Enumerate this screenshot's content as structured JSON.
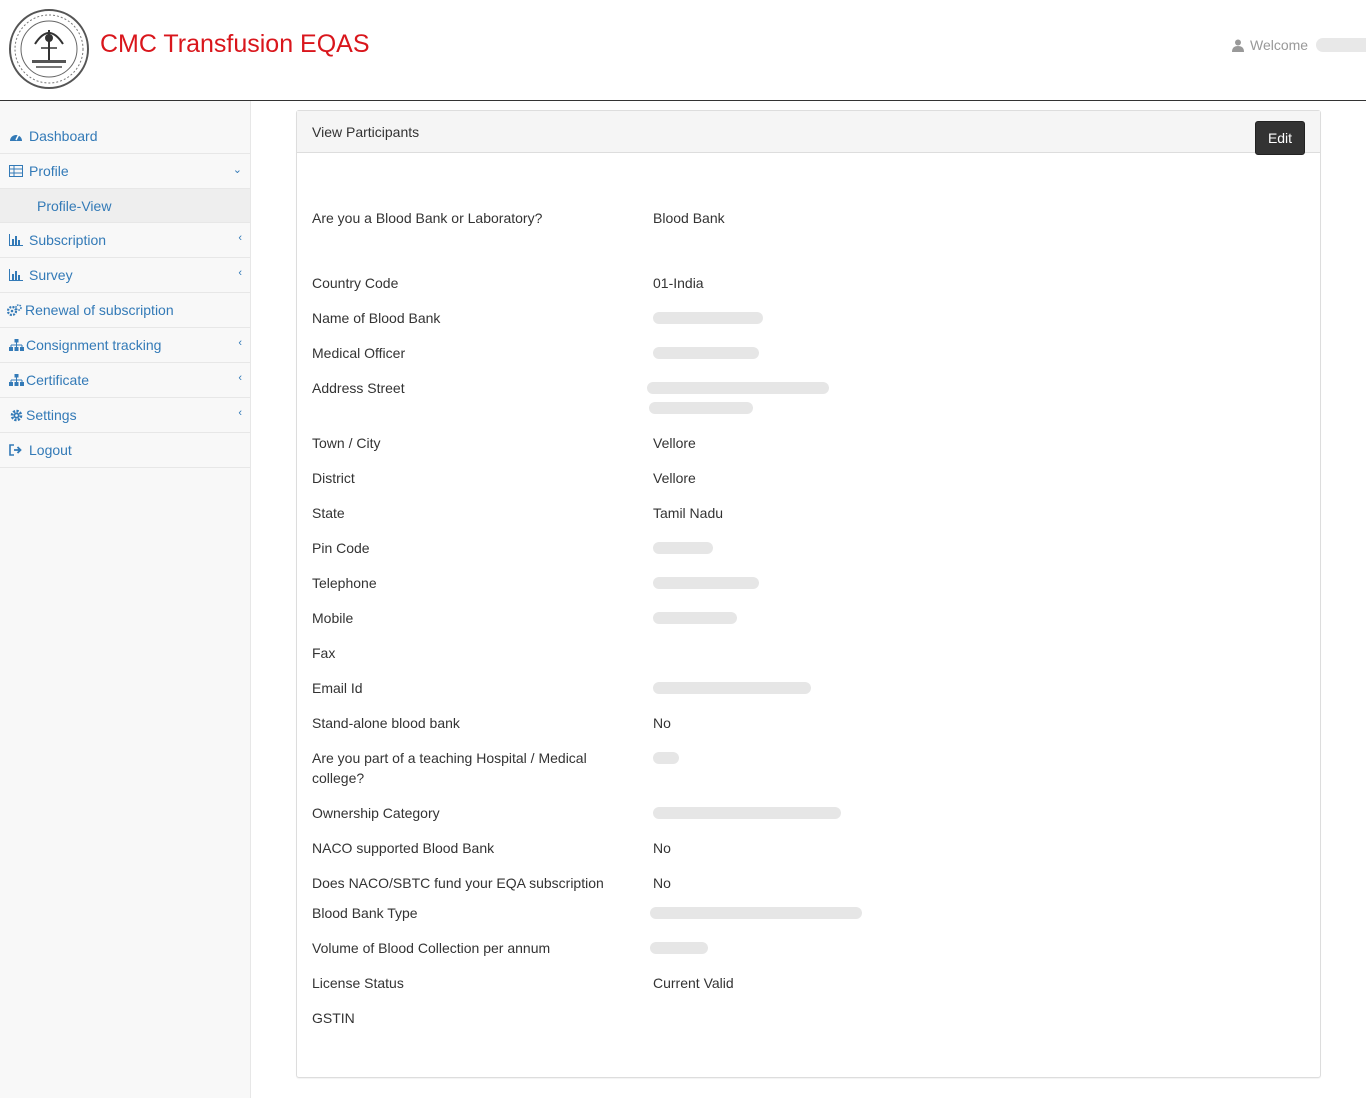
{
  "header": {
    "app_title": "CMC Transfusion EQAS",
    "welcome_label": "Welcome"
  },
  "sidebar": {
    "items": [
      {
        "label": "Dashboard",
        "icon": "dashboard-icon"
      },
      {
        "label": "Profile",
        "icon": "table-icon",
        "expanded": true
      },
      {
        "label": "Profile-View",
        "sub": true
      },
      {
        "label": "Subscription",
        "icon": "bar-chart-icon"
      },
      {
        "label": "Survey",
        "icon": "bar-chart-icon"
      },
      {
        "label": "Renewal of subscription",
        "icon": "gears-icon"
      },
      {
        "label": "Consignment tracking",
        "icon": "sitemap-icon"
      },
      {
        "label": "Certificate",
        "icon": "sitemap-icon"
      },
      {
        "label": "Settings",
        "icon": "gear-icon"
      },
      {
        "label": "Logout",
        "icon": "sign-out-icon"
      }
    ]
  },
  "panel": {
    "title": "View Participants",
    "edit_label": "Edit",
    "fields": [
      {
        "label": "Are you a Blood Bank or Laboratory?",
        "value": "Blood Bank"
      },
      {
        "label": "Country Code",
        "value": "01-India"
      },
      {
        "label": "Name of Blood Bank",
        "value": ""
      },
      {
        "label": "Medical Officer",
        "value": ""
      },
      {
        "label": "Address Street",
        "value": ""
      },
      {
        "label": "Town / City",
        "value": "Vellore"
      },
      {
        "label": "District",
        "value": "Vellore"
      },
      {
        "label": "State",
        "value": "Tamil Nadu"
      },
      {
        "label": "Pin Code",
        "value": ""
      },
      {
        "label": "Telephone",
        "value": ""
      },
      {
        "label": "Mobile",
        "value": ""
      },
      {
        "label": "Fax",
        "value": ""
      },
      {
        "label": "Email Id",
        "value": ""
      },
      {
        "label": "Stand-alone blood bank",
        "value": "No"
      },
      {
        "label": "Are you part of a teaching Hospital / Medical college?",
        "value": ""
      },
      {
        "label": "Ownership Category",
        "value": ""
      },
      {
        "label": "NACO supported Blood Bank",
        "value": "No"
      },
      {
        "label": "Does NACO/SBTC fund your EQA subscription",
        "value": "No"
      },
      {
        "label": "Blood Bank Type",
        "value": ""
      },
      {
        "label": "Volume of Blood Collection per annum",
        "value": ""
      },
      {
        "label": "License Status",
        "value": "Current Valid"
      },
      {
        "label": "GSTIN",
        "value": ""
      }
    ]
  }
}
